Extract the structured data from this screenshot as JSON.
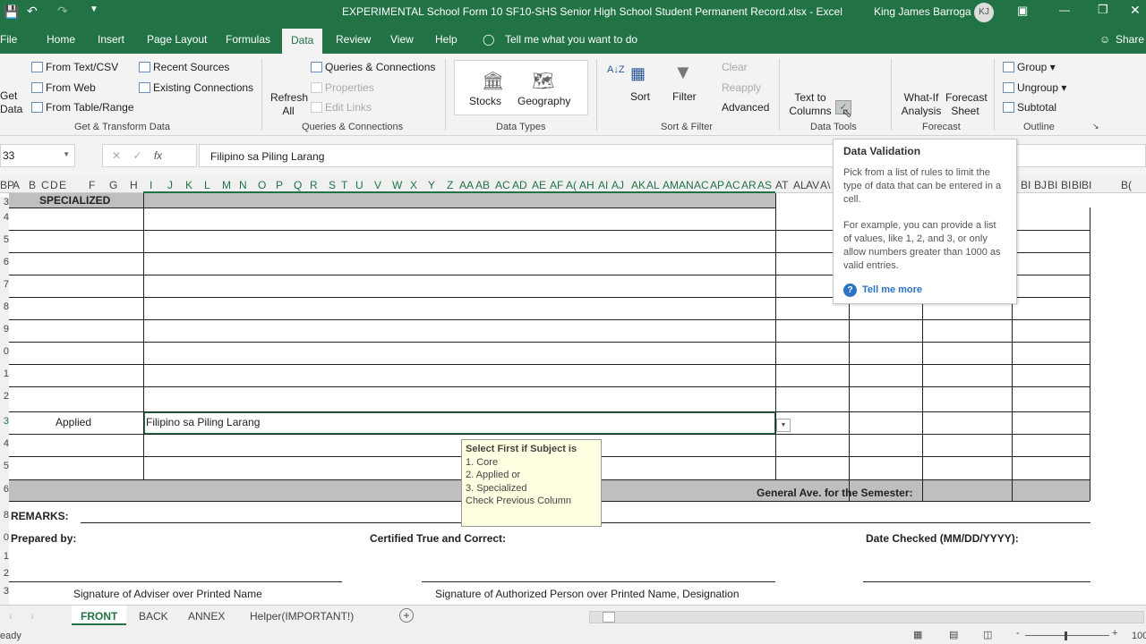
{
  "title": {
    "text": "EXPERIMENTAL School Form 10 SF10-SHS Senior High School Student Permanent Record.xlsx  -  Excel",
    "user": "King James Barroga",
    "initials": "KJ"
  },
  "tabs": [
    "File",
    "Home",
    "Insert",
    "Page Layout",
    "Formulas",
    "Data",
    "Review",
    "View",
    "Help"
  ],
  "tell_me": "Tell me what you want to do",
  "share": "Share",
  "ribbon": {
    "get_data": "Get Data",
    "get_transform": [
      "From Text/CSV",
      "From Web",
      "From Table/Range",
      "Recent Sources",
      "Existing Connections"
    ],
    "refresh_all": "Refresh All",
    "queries": [
      "Queries & Connections",
      "Properties",
      "Edit Links"
    ],
    "data_types": [
      "Stocks",
      "Geography"
    ],
    "sort": "Sort",
    "filter": "Filter",
    "clear": "Clear",
    "reapply": "Reapply",
    "advanced": "Advanced",
    "text_to_columns": "Text to Columns",
    "what_if": "What-If Analysis",
    "forecast_sheet": "Forecast Sheet",
    "outline": [
      "Group",
      "Ungroup",
      "Subtotal"
    ],
    "groups": [
      "Get & Transform Data",
      "Queries & Connections",
      "Data Types",
      "Sort & Filter",
      "Data Tools",
      "Forecast",
      "Outline"
    ]
  },
  "formula_bar": {
    "name_box": "33",
    "fx": "fx",
    "value": "Filipino sa Piling Larang"
  },
  "columns": [
    "A",
    "B",
    "C",
    "D",
    "E",
    "F",
    "G",
    "H",
    "I",
    "J",
    "K",
    "L",
    "M",
    "N",
    "O",
    "P",
    "Q",
    "R",
    "S",
    "T",
    "U",
    "V",
    "W",
    "X",
    "Y",
    "Z",
    "AA",
    "AB",
    "AC",
    "AD",
    "AE",
    "AF",
    "A(",
    "AH",
    "AI",
    "AJ",
    "AK",
    "AL",
    "AM",
    "AN",
    "AC",
    "AP",
    "AC",
    "AR",
    "AS",
    "AT",
    "AL",
    "AV",
    "A\\",
    "BI",
    "BJ",
    "BI",
    "BI",
    "BI",
    "BI",
    "B(",
    "BP"
  ],
  "rows": [
    "3",
    "4",
    "5",
    "6",
    "7",
    "8",
    "9",
    "0",
    "1",
    "2",
    "3",
    "4",
    "5",
    "6",
    "8",
    "0",
    "1",
    "2",
    "3"
  ],
  "sheet": {
    "specialized": "SPECIALIZED",
    "applied": "Applied",
    "subject": "Filipino sa Piling Larang",
    "general_ave": "General Ave. for the Semester:",
    "remarks": "REMARKS:",
    "prepared_by": "Prepared by:",
    "certified": "Certified True and Correct:",
    "date_checked": "Date Checked (MM/DD/YYYY):",
    "sig_adviser": "Signature of Adviser over Printed Name",
    "sig_authorized": "Signature of Authorized Person over Printed Name, Designation"
  },
  "input_message": {
    "title": "Select First if Subject is",
    "lines": [
      "1. Core",
      "2. Applied or",
      "3. Specialized",
      "Check Previous Column"
    ]
  },
  "tooltip": {
    "title": "Data Validation",
    "p1": "Pick from a list of rules to limit the type of data that can be entered in a cell.",
    "p2": "For example, you can provide a list of values, like 1, 2, and 3, or only allow numbers greater than 1000 as valid entries.",
    "link": "Tell me more"
  },
  "sheet_tabs": [
    "FRONT",
    "BACK",
    "ANNEX",
    "Helper(IMPORTANT!)"
  ],
  "status": {
    "text": "eady",
    "zoom": "100"
  },
  "colors": {
    "accent": "#217346"
  }
}
